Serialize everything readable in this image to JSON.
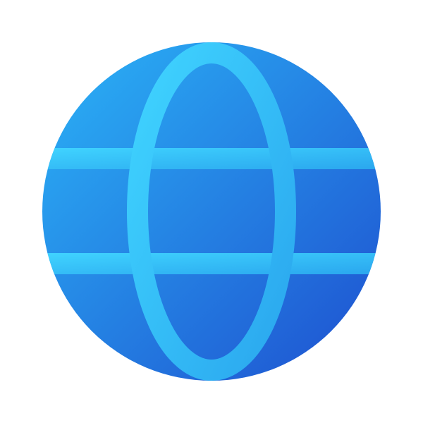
{
  "icon": {
    "name": "globe-icon",
    "colors": {
      "background": "#ffffff",
      "sphere_light": "#2bb4f7",
      "sphere_dark": "#1e4fcf",
      "grid_light": "#40d4ff",
      "grid_dark": "#2aa6ee"
    }
  }
}
